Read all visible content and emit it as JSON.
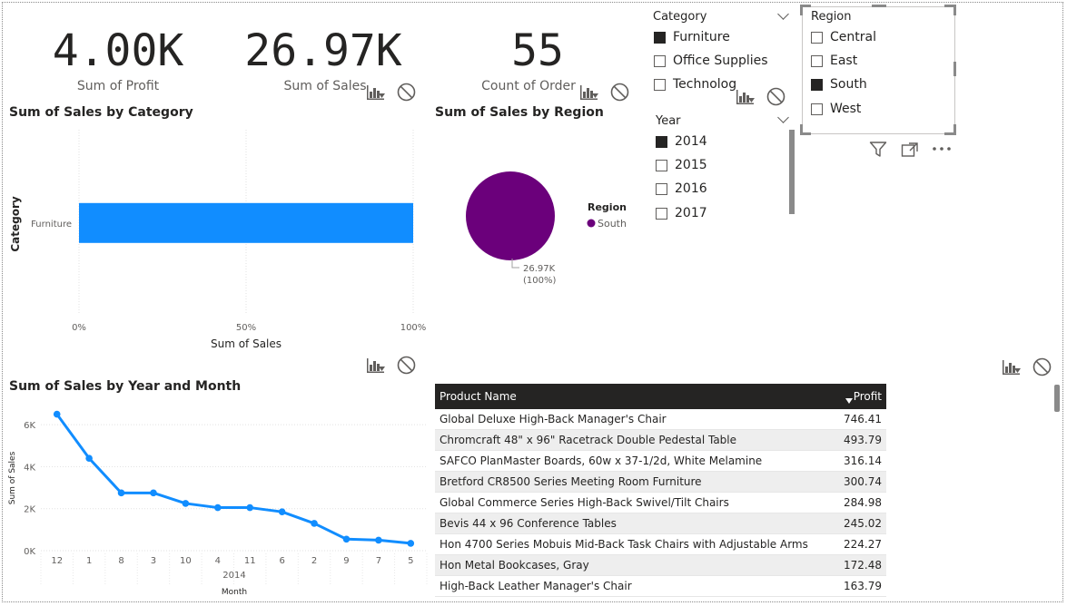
{
  "kpis": [
    {
      "value": "4.00K",
      "label": "Sum of Profit"
    },
    {
      "value": "26.97K",
      "label": "Sum of Sales"
    },
    {
      "value": "55",
      "label": "Count of Order"
    }
  ],
  "category_slicer": {
    "header": "Category",
    "items": [
      {
        "label": "Furniture",
        "checked": true
      },
      {
        "label": "Office Supplies",
        "checked": false
      },
      {
        "label": "Technolog",
        "checked": false
      }
    ]
  },
  "year_slicer": {
    "header": "Year",
    "items": [
      {
        "label": "2014",
        "checked": true
      },
      {
        "label": "2015",
        "checked": false
      },
      {
        "label": "2016",
        "checked": false
      },
      {
        "label": "2017",
        "checked": false
      }
    ]
  },
  "region_slicer": {
    "header": "Region",
    "items": [
      {
        "label": "Central",
        "checked": false
      },
      {
        "label": "East",
        "checked": false
      },
      {
        "label": "South",
        "checked": true
      },
      {
        "label": "West",
        "checked": false
      }
    ]
  },
  "icons": {
    "analytics": "chart-analytics-icon",
    "block": "no-entry-icon",
    "filter": "filter-icon",
    "focus": "focus-mode-icon",
    "more": "more-options-icon"
  },
  "colors": {
    "accent": "#118DFF",
    "pie": "#6B007B",
    "header_bg": "#252423"
  },
  "chart_data": [
    {
      "type": "bar",
      "title": "Sum of Sales by Category",
      "xlabel": "Sum of Sales",
      "ylabel": "Category",
      "categories": [
        "Furniture"
      ],
      "values": [
        100
      ],
      "xticks": [
        "0%",
        "50%",
        "100%"
      ],
      "xlim": [
        0,
        100
      ]
    },
    {
      "type": "pie",
      "title": "Sum of Sales by Region",
      "legend_title": "Region",
      "slices": [
        {
          "label": "South",
          "value": 100,
          "data_label": "26.97K",
          "pct_label": "(100%)"
        }
      ]
    },
    {
      "type": "line",
      "title": "Sum of Sales by Year and Month",
      "xlabel": "Month",
      "ylabel": "Sum of Sales",
      "x": [
        "12",
        "1",
        "8",
        "3",
        "10",
        "4",
        "11",
        "6",
        "2",
        "9",
        "7",
        "5"
      ],
      "x_group": "2014",
      "y": [
        6500,
        4400,
        2750,
        2750,
        2250,
        2050,
        2050,
        1850,
        1300,
        550,
        500,
        350
      ],
      "yticks": [
        "0K",
        "2K",
        "4K",
        "6K"
      ],
      "ylim": [
        0,
        7000
      ]
    }
  ],
  "table": {
    "columns": [
      "Product Name",
      "Profit"
    ],
    "rows": [
      [
        "Global Deluxe High-Back Manager's Chair",
        "746.41"
      ],
      [
        "Chromcraft 48\" x 96\" Racetrack Double Pedestal Table",
        "493.79"
      ],
      [
        "SAFCO PlanMaster Boards, 60w x 37-1/2d, White Melamine",
        "316.14"
      ],
      [
        "Bretford CR8500 Series Meeting Room Furniture",
        "300.74"
      ],
      [
        "Global Commerce Series High-Back Swivel/Tilt Chairs",
        "284.98"
      ],
      [
        "Bevis 44 x 96 Conference Tables",
        "245.02"
      ],
      [
        "Hon 4700 Series Mobuis Mid-Back Task Chairs with Adjustable Arms",
        "224.27"
      ],
      [
        "Hon Metal Bookcases, Gray",
        "172.48"
      ],
      [
        "High-Back Leather Manager's Chair",
        "163.79"
      ]
    ]
  }
}
